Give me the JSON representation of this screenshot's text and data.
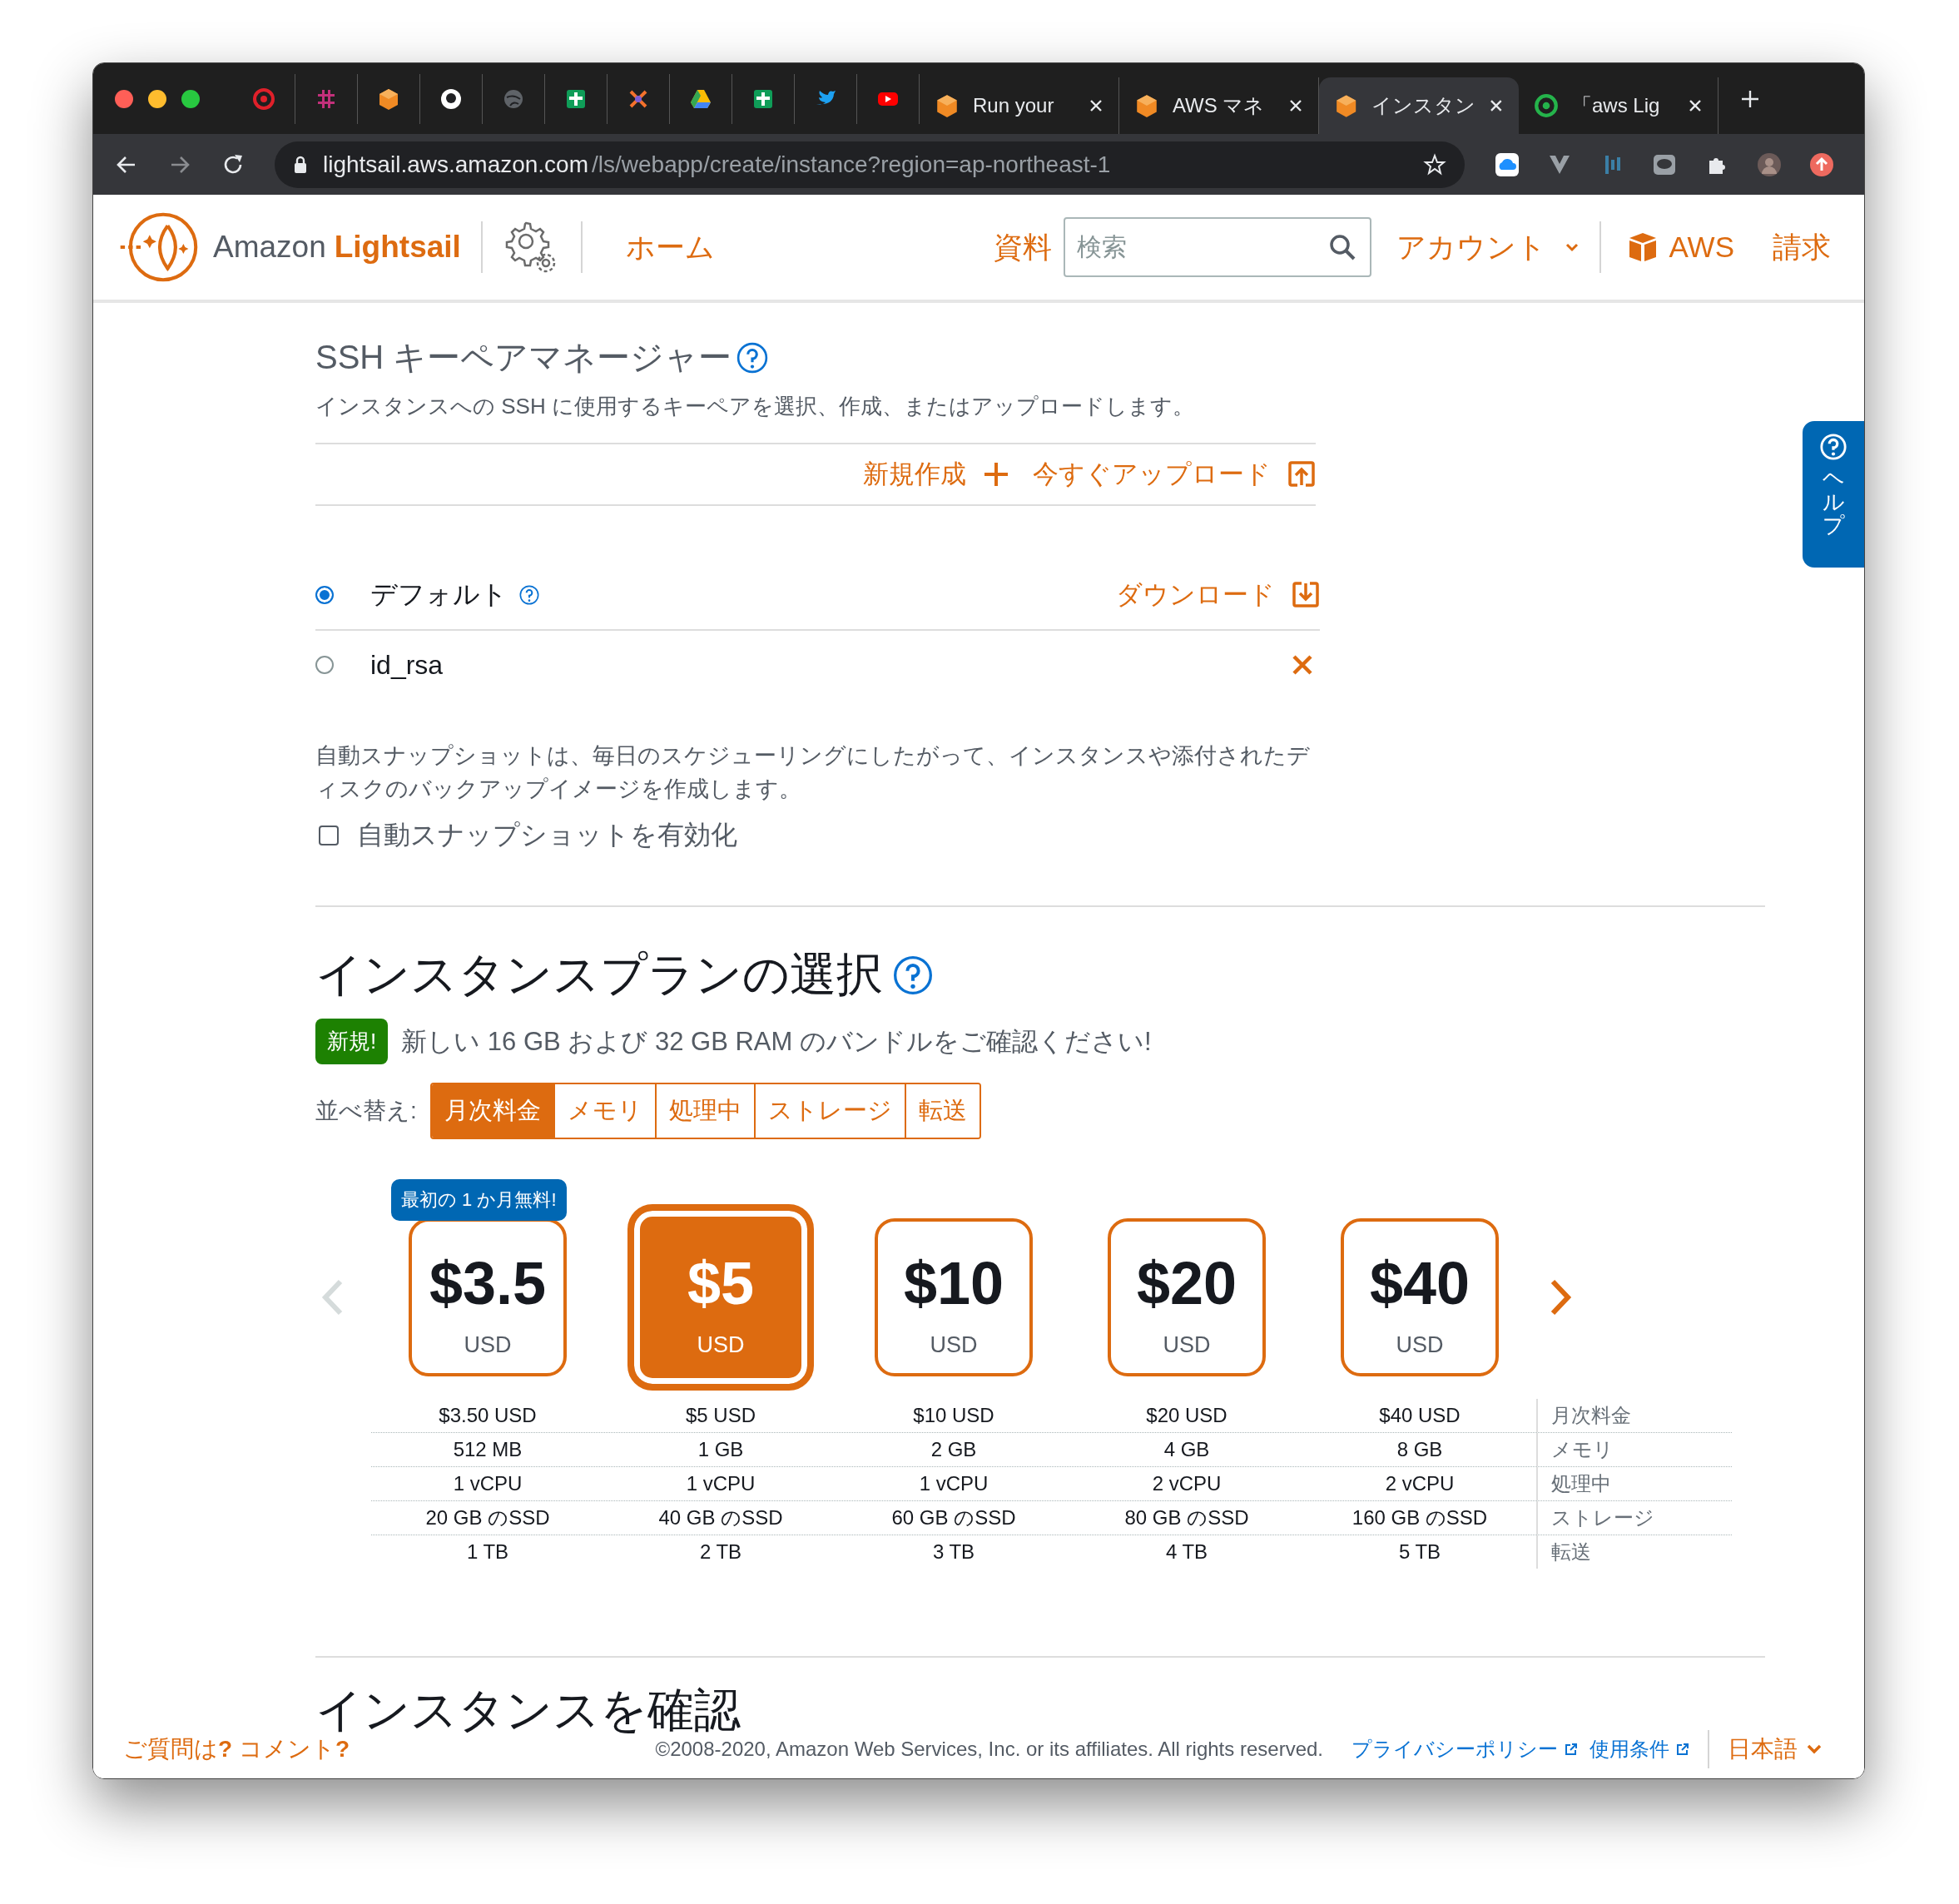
{
  "browser": {
    "tabs": [
      {
        "title": "Run your",
        "selected": false
      },
      {
        "title": "AWS マネ",
        "selected": false
      },
      {
        "title": "インスタン",
        "selected": true
      },
      {
        "title": "「aws Lig",
        "selected": false
      }
    ],
    "address": {
      "host": "lightsail.aws.amazon.com",
      "path": "/ls/webapp/create/instance?region=ap-northeast-1"
    }
  },
  "header": {
    "brand": "Amazon",
    "product": "Lightsail",
    "home": "ホーム",
    "docs": "資料",
    "search": {
      "placeholder": "検索"
    },
    "account": "アカウント",
    "aws": "AWS",
    "billing": "請求"
  },
  "ssh": {
    "title": "SSH キーペアマネージャー",
    "description": "インスタンスへの SSH に使用するキーペアを選択、作成、またはアップロードします。",
    "actions": [
      {
        "kind": "create",
        "label": "新規作成"
      },
      {
        "kind": "upload",
        "label": "今すぐアップロード"
      }
    ],
    "keys": [
      {
        "name": "デフォルト",
        "selected": true,
        "help": true,
        "action": {
          "kind": "download",
          "label": "ダウンロード"
        }
      },
      {
        "name": "id_rsa",
        "selected": false,
        "help": false,
        "action": {
          "kind": "delete"
        }
      }
    ]
  },
  "snapshot": {
    "description": "自動スナップショットは、毎日のスケジューリングにしたがって、インスタンスや添付されたディスクのバックアップイメージを作成します。",
    "checkbox": {
      "label": "自動スナップショットを有効化",
      "checked": false
    }
  },
  "plans": {
    "title": "インスタンスプランの選択",
    "new_badge": "新規!",
    "announcement": "新しい 16 GB および 32 GB RAM のバンドルをご確認ください!",
    "sort_label": "並べ替え:",
    "sort_options": [
      {
        "label": "月次料金",
        "selected": true
      },
      {
        "label": "メモリ",
        "selected": false
      },
      {
        "label": "処理中",
        "selected": false
      },
      {
        "label": "ストレージ",
        "selected": false
      },
      {
        "label": "転送",
        "selected": false
      }
    ],
    "prev_disabled": true,
    "cards": [
      {
        "price": "$3.5",
        "currency": "USD",
        "selected": false,
        "promo": "最初の 1 か月無料!"
      },
      {
        "price": "$5",
        "currency": "USD",
        "selected": true
      },
      {
        "price": "$10",
        "currency": "USD",
        "selected": false
      },
      {
        "price": "$20",
        "currency": "USD",
        "selected": false
      },
      {
        "price": "$40",
        "currency": "USD",
        "selected": false
      }
    ],
    "specs": [
      {
        "label": "月次料金",
        "values": [
          "$3.50 USD",
          "$5 USD",
          "$10 USD",
          "$20 USD",
          "$40 USD"
        ]
      },
      {
        "label": "メモリ",
        "values": [
          "512 MB",
          "1 GB",
          "2 GB",
          "4 GB",
          "8 GB"
        ]
      },
      {
        "label": "処理中",
        "values": [
          "1 vCPU",
          "1 vCPU",
          "1 vCPU",
          "2 vCPU",
          "2 vCPU"
        ]
      },
      {
        "label": "ストレージ",
        "values": [
          "20 GB のSSD",
          "40 GB のSSD",
          "60 GB のSSD",
          "80 GB のSSD",
          "160 GB のSSD"
        ]
      },
      {
        "label": "転送",
        "values": [
          "1 TB",
          "2 TB",
          "3 TB",
          "4 TB",
          "5 TB"
        ]
      }
    ]
  },
  "confirm": {
    "title": "インスタンスを確認"
  },
  "footer": {
    "feedback": "ご質問は**?** コメント**?**",
    "copyright": "©2008-2020, Amazon Web Services, Inc. or its affiliates. All rights reserved.",
    "links": [
      "プライバシーポリシー",
      "使用条件"
    ],
    "language": "日本語"
  },
  "help_tab": {
    "label": "ヘルプ"
  }
}
